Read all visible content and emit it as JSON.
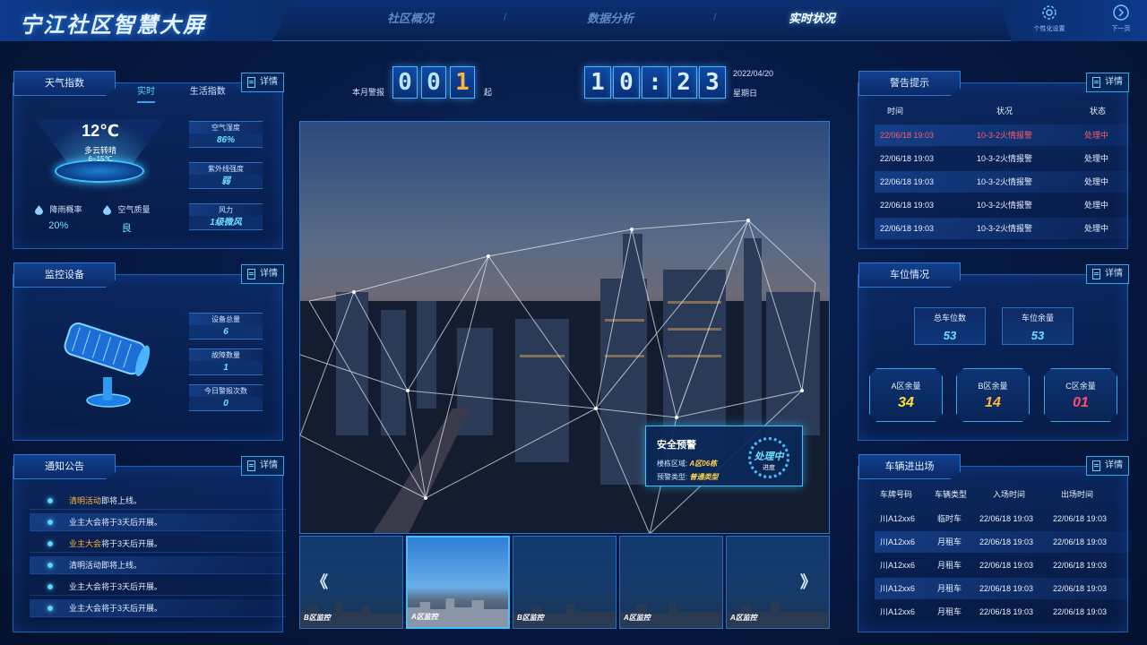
{
  "header": {
    "title": "宁江社区智慧大屏",
    "tabs": [
      "社区概况",
      "数据分析",
      "实时状况"
    ],
    "active_tab": 2,
    "settings_label": "个性化设置",
    "next_label": "下一页"
  },
  "weather": {
    "title": "天气指数",
    "tab_realtime": "实时",
    "tab_life": "生活指数",
    "detail_label": "详情",
    "temperature": "12℃",
    "description": "多云转晴",
    "range": "6~15℃",
    "humidity_label": "空气湿度",
    "humidity_value": "86%",
    "uv_label": "紫外线强度",
    "uv_value": "弱",
    "wind_label": "风力",
    "wind_value": "1级微风",
    "rain_label": "降雨概率",
    "rain_value": "20%",
    "air_label": "空气质量",
    "air_value": "良"
  },
  "monitor": {
    "title": "监控设备",
    "detail_label": "详情",
    "total_label": "设备总量",
    "total_value": "6",
    "fault_label": "故障数量",
    "fault_value": "1",
    "alarm_label": "今日警报次数",
    "alarm_value": "0"
  },
  "notices": {
    "title": "通知公告",
    "detail_label": "详情",
    "items": [
      {
        "highlight": "清明活动",
        "text": "即将上线。"
      },
      {
        "highlight": "",
        "text": "业主大会将于3天后开展。"
      },
      {
        "highlight": "业主大会",
        "text": "将于3天后开展。"
      },
      {
        "highlight": "",
        "text": "清明活动即将上线。"
      },
      {
        "highlight": "",
        "text": "业主大会将于3天后开展。"
      },
      {
        "highlight": "",
        "text": "业主大会将于3天后开展。"
      }
    ]
  },
  "counter": {
    "label": "本月警报",
    "digits": [
      "0",
      "0",
      "1"
    ],
    "unit": "起"
  },
  "clock": {
    "digits": [
      "1",
      "0",
      ":",
      "2",
      "3"
    ],
    "date": "2022/04/20",
    "weekday": "星期日"
  },
  "alert_card": {
    "title": "安全预警",
    "area_label": "楼栋区域:",
    "area_value": "A区06栋",
    "type_label": "预警类型:",
    "type_value": "普通类型",
    "status": "处理中",
    "status_sub": "进度"
  },
  "thumbnails": [
    {
      "caption": "B区监控"
    },
    {
      "caption": "A区监控"
    },
    {
      "caption": "B区监控"
    },
    {
      "caption": "A区监控"
    },
    {
      "caption": "A区监控"
    }
  ],
  "nav_prev": "《",
  "nav_next": "》",
  "warnings": {
    "title": "警告提示",
    "detail_label": "详情",
    "headers": [
      "时间",
      "状况",
      "状态"
    ],
    "rows": [
      {
        "time": "22/06/18  19:03",
        "event": "10-3-2火情报警",
        "status": "处理中"
      },
      {
        "time": "22/06/18  19:03",
        "event": "10-3-2火情报警",
        "status": "处理中"
      },
      {
        "time": "22/06/18  19:03",
        "event": "10-3-2火情报警",
        "status": "处理中"
      },
      {
        "time": "22/06/18  19:03",
        "event": "10-3-2火情报警",
        "status": "处理中"
      },
      {
        "time": "22/06/18  19:03",
        "event": "10-3-2火情报警",
        "status": "处理中"
      }
    ]
  },
  "parking": {
    "title": "车位情况",
    "detail_label": "详情",
    "total_label": "总车位数",
    "total_value": "53",
    "left_label": "车位余量",
    "left_value": "53",
    "zone_a_label": "A区余量",
    "zone_a_value": "34",
    "zone_b_label": "B区余量",
    "zone_b_value": "14",
    "zone_c_label": "C区余量",
    "zone_c_value": "01",
    "colors": {
      "a": "#ffe033",
      "b": "#ffb43b",
      "c": "#ff4e6a"
    }
  },
  "vehicles": {
    "title": "车辆进出场",
    "detail_label": "详情",
    "headers": [
      "车牌号码",
      "车辆类型",
      "入场时间",
      "出场时间"
    ],
    "rows": [
      {
        "plate": "川A12xx6",
        "type": "临时车",
        "in": "22/06/18  19:03",
        "out": "22/06/18  19:03"
      },
      {
        "plate": "川A12xx6",
        "type": "月租车",
        "in": "22/06/18  19:03",
        "out": "22/06/18  19:03"
      },
      {
        "plate": "川A12xx6",
        "type": "月租车",
        "in": "22/06/18  19:03",
        "out": "22/06/18  19:03"
      },
      {
        "plate": "川A12xx6",
        "type": "月租车",
        "in": "22/06/18  19:03",
        "out": "22/06/18  19:03"
      },
      {
        "plate": "川A12xx6",
        "type": "月租车",
        "in": "22/06/18  19:03",
        "out": "22/06/18  19:03"
      }
    ]
  }
}
